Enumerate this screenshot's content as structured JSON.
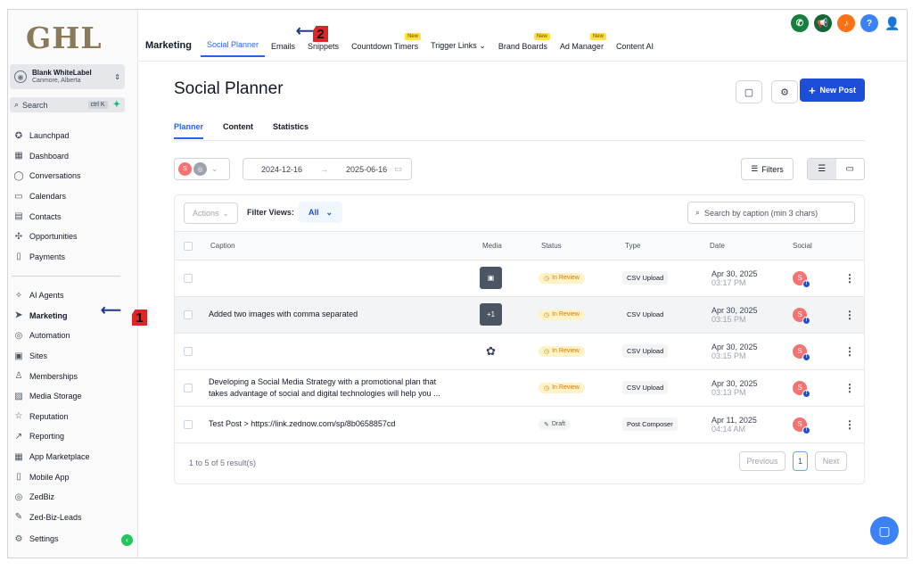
{
  "sidebar": {
    "logo": "GHL",
    "account": {
      "name": "Blank WhiteLabel",
      "location": "Canmore, Alberta"
    },
    "search": {
      "label": "Search",
      "shortcut": "ctrl K"
    },
    "items_top": [
      {
        "label": "Launchpad",
        "icon": "rocket-icon",
        "glyph": "✪"
      },
      {
        "label": "Dashboard",
        "icon": "dashboard-icon",
        "glyph": "▦"
      },
      {
        "label": "Conversations",
        "icon": "chat-icon",
        "glyph": "◯"
      },
      {
        "label": "Calendars",
        "icon": "calendar-icon",
        "glyph": "▭"
      },
      {
        "label": "Contacts",
        "icon": "contacts-icon",
        "glyph": "▤"
      },
      {
        "label": "Opportunities",
        "icon": "opportunities-icon",
        "glyph": "✣"
      },
      {
        "label": "Payments",
        "icon": "payments-icon",
        "glyph": "▯"
      }
    ],
    "items_bottom": [
      {
        "label": "AI Agents",
        "icon": "sparkle-icon",
        "glyph": "✧"
      },
      {
        "label": "Marketing",
        "icon": "send-icon",
        "glyph": "➤"
      },
      {
        "label": "Automation",
        "icon": "automation-icon",
        "glyph": "◎"
      },
      {
        "label": "Sites",
        "icon": "sites-icon",
        "glyph": "▣"
      },
      {
        "label": "Memberships",
        "icon": "memberships-icon",
        "glyph": "♙"
      },
      {
        "label": "Media Storage",
        "icon": "media-icon",
        "glyph": "▨"
      },
      {
        "label": "Reputation",
        "icon": "star-icon",
        "glyph": "☆"
      },
      {
        "label": "Reporting",
        "icon": "chart-icon",
        "glyph": "↗"
      },
      {
        "label": "App Marketplace",
        "icon": "apps-icon",
        "glyph": "▦"
      },
      {
        "label": "Mobile App",
        "icon": "mobile-icon",
        "glyph": "▯"
      },
      {
        "label": "ZedBiz",
        "icon": "zedbiz-icon",
        "glyph": "◎"
      },
      {
        "label": "Zed-Biz-Leads",
        "icon": "wrench-icon",
        "glyph": "🔧"
      }
    ],
    "settings": {
      "label": "Settings",
      "icon": "gear-icon",
      "glyph": "⚙"
    }
  },
  "topbar": {
    "section": "Marketing",
    "tabs": [
      {
        "label": "Social Planner",
        "new": ""
      },
      {
        "label": "Emails",
        "new": ""
      },
      {
        "label": "Snippets",
        "new": ""
      },
      {
        "label": "Countdown Timers",
        "new": "New"
      },
      {
        "label": "Trigger Links",
        "new": ""
      },
      {
        "label": "Brand Boards",
        "new": "New"
      },
      {
        "label": "Ad Manager",
        "new": "New"
      },
      {
        "label": "Content AI",
        "new": ""
      }
    ]
  },
  "page": {
    "title": "Social Planner",
    "new_post": "New Post",
    "subtabs": [
      "Planner",
      "Content",
      "Statistics"
    ],
    "date_start": "2024-12-16",
    "date_end": "2025-06-16",
    "filters": "Filters",
    "actions": "Actions",
    "filter_views_label": "Filter Views:",
    "filter_views_value": "All",
    "search_placeholder": "Search by caption (min 3 chars)",
    "columns": {
      "caption": "Caption",
      "media": "Media",
      "status": "Status",
      "type": "Type",
      "date": "Date",
      "social": "Social"
    },
    "rows": [
      {
        "caption1": "",
        "caption2": "",
        "media": "▣",
        "status": "In Review",
        "type": "CSV Upload",
        "date": "Apr 30, 2025",
        "time": "03:17 PM"
      },
      {
        "caption1": "Added two images with comma separated",
        "caption2": "",
        "media": "+1",
        "status": "In Review",
        "type": "CSV Upload",
        "date": "Apr 30, 2025",
        "time": "03:15 PM"
      },
      {
        "caption1": "",
        "caption2": "",
        "media": "✿",
        "status": "In Review",
        "type": "CSV Upload",
        "date": "Apr 30, 2025",
        "time": "03:15 PM"
      },
      {
        "caption1": "Developing a Social Media Strategy with a promotional plan that",
        "caption2": "takes advantage of social and digital technologies will help you ...",
        "media": "",
        "status": "In Review",
        "type": "CSV Upload",
        "date": "Apr 30, 2025",
        "time": "03:13 PM"
      },
      {
        "caption1": "Test Post > https://link.zednow.com/sp/8b0658857cd",
        "caption2": "",
        "media": "",
        "status": "Draft",
        "type": "Post Composer",
        "date": "Apr 11, 2025",
        "time": "04:14 AM"
      }
    ],
    "result_count": "1 to 5 of 5 result(s)",
    "pagination": {
      "prev": "Previous",
      "current": "1",
      "next": "Next"
    }
  },
  "annotations": {
    "one": "1",
    "two": "2"
  },
  "colors": {
    "accent": "#2563eb",
    "primary_button": "#1d4ed8",
    "review": "#d97706"
  }
}
